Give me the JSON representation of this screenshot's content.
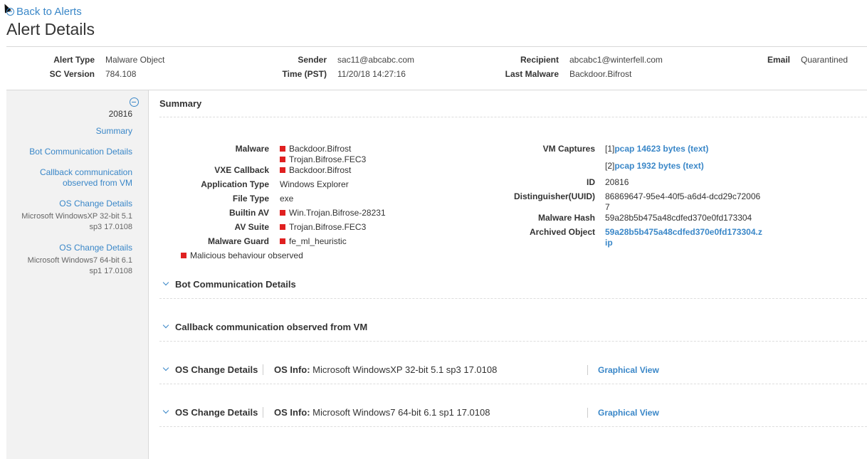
{
  "header": {
    "back_label": "Back to Alerts",
    "title": "Alert Details"
  },
  "meta": {
    "col1": [
      {
        "key": "Alert Type",
        "value": "Malware Object"
      },
      {
        "key": "SC Version",
        "value": "784.108"
      }
    ],
    "col2": [
      {
        "key": "Sender",
        "value": "sac11@abcabc.com"
      },
      {
        "key": "Time (PST)",
        "value": "11/20/18 14:27:16"
      }
    ],
    "col3": [
      {
        "key": "Recipient",
        "value": "abcabc1@winterfell.com"
      },
      {
        "key": "Last Malware",
        "value": "Backdoor.Bifrost"
      }
    ],
    "col4": [
      {
        "key": "Email",
        "value": "Quarantined"
      }
    ]
  },
  "sidebar": {
    "id": "20816",
    "links": [
      {
        "label": "Summary"
      },
      {
        "label": "Bot Communication Details"
      },
      {
        "label": "Callback communication observed from VM"
      },
      {
        "label": "OS Change Details",
        "note": "Microsoft WindowsXP 32-bit 5.1 sp3 17.0108"
      },
      {
        "label": "OS Change Details",
        "note": "Microsoft Windows7 64-bit 6.1 sp1 17.0108"
      }
    ]
  },
  "summary": {
    "title": "Summary",
    "left": {
      "malware_label": "Malware",
      "malware_values": [
        "Backdoor.Bifrost",
        "Trojan.Bifrose.FEC3"
      ],
      "vxe_label": "VXE Callback",
      "vxe_value": "Backdoor.Bifrost",
      "app_label": "Application Type",
      "app_value": "Windows Explorer",
      "file_label": "File Type",
      "file_value": "exe",
      "builtin_label": "Builtin AV",
      "builtin_value": "Win.Trojan.Bifrose-28231",
      "avsuite_label": "AV Suite",
      "avsuite_value": "Trojan.Bifrose.FEC3",
      "guard_label": "Malware Guard",
      "guard_value": "fe_ml_heuristic",
      "malicious_note": "Malicious behaviour observed"
    },
    "right": {
      "vm_label": "VM Captures",
      "vm_captures": [
        {
          "prefix": "[1]",
          "link": "pcap 14623 bytes (text)"
        },
        {
          "prefix": "[2]",
          "link": "pcap 1932 bytes (text)"
        }
      ],
      "id_label": "ID",
      "id_value": "20816",
      "uuid_label": "Distinguisher(UUID)",
      "uuid_line1": "86869647-95e4-40f5-a6d4-dcd29c72006",
      "uuid_line2": "7",
      "hash_label": "Malware Hash",
      "hash_value": "59a28b5b475a48cdfed370e0fd173304",
      "archived_label": "Archived Object",
      "archived_line1": "59a28b5b475a48cdfed370e0fd173304.z",
      "archived_line2": "ip"
    }
  },
  "sections": {
    "bot": "Bot Communication Details",
    "callback": "Callback communication observed from VM",
    "os1": {
      "title": "OS Change Details",
      "info_label": "OS Info:",
      "info_value": "Microsoft WindowsXP 32-bit 5.1 sp3 17.0108",
      "graph": "Graphical View"
    },
    "os2": {
      "title": "OS Change Details",
      "info_label": "OS Info:",
      "info_value": "Microsoft Windows7 64-bit 6.1 sp1 17.0108",
      "graph": "Graphical View"
    }
  },
  "colors": {
    "link": "#3a87c8",
    "flag": "#e02020"
  }
}
